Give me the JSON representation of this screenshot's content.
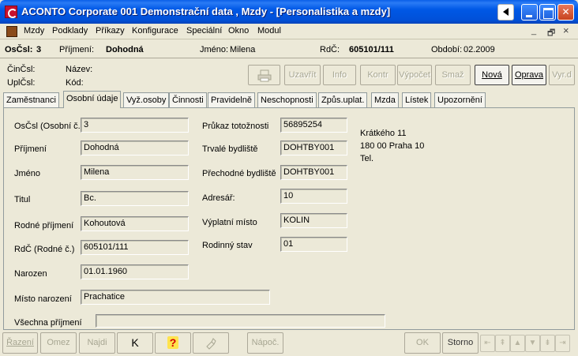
{
  "window": {
    "title": "ACONTO Corporate 001 Demonstrační data , Mzdy - [Personalistika a mzdy]"
  },
  "menu": [
    "Mzdy",
    "Podklady",
    "Příkazy",
    "Konfigurace",
    "Speciální",
    "Okno",
    "Modul"
  ],
  "mdi_controls": {
    "minimize": "_",
    "restore": "🗗",
    "close": "×"
  },
  "header": {
    "oscsl_label": "OsČsl:",
    "oscsl_value": "3",
    "prijmeni_label": "Příjmení:",
    "prijmeni_value": "Dohodná",
    "jmeno_label": "Jméno:",
    "jmeno_value": "Milena",
    "rdc_label": "RdČ:",
    "rdc_value": "605101/111",
    "obdobi_label": "Období:",
    "obdobi_value": "02.2009"
  },
  "info": {
    "cincsl": "ČinČsl:",
    "nazev": "Název:",
    "uplcsl": "UplČsl:",
    "kod": "Kód:"
  },
  "toolbar": {
    "print_icon": "printer-icon",
    "uzavrit": "Uzavřít",
    "info": "Info",
    "kontr": "Kontr",
    "vypocet": "Výpočet",
    "smaz": "Smaž",
    "nova": "Nová",
    "oprava": "Oprava",
    "vyrd": "Vyr.d"
  },
  "tabs": [
    "Zaměstnanci",
    "Osobní údaje",
    "Vyž.osoby",
    "Činnosti",
    "Pravidelně",
    "Neschopnosti",
    "Způs.uplat.",
    "Mzda",
    "Lístek",
    "Upozornění"
  ],
  "active_tab": "Osobní údaje",
  "form": {
    "oscsl": {
      "label": "OsČsl (Osobní č.)",
      "value": "3"
    },
    "prijmeni": {
      "label": "Příjmení",
      "value": "Dohodná"
    },
    "jmeno": {
      "label": "Jméno",
      "value": "Milena"
    },
    "titul": {
      "label": "Titul",
      "value": "Bc."
    },
    "rodne_prijmeni": {
      "label": "Rodné příjmení",
      "value": "Kohoutová"
    },
    "rdc": {
      "label": "RdČ (Rodné č.)",
      "value": "605101/111"
    },
    "narozen": {
      "label": "Narozen",
      "value": "01.01.1960"
    },
    "misto_narozeni": {
      "label": "Místo narození",
      "value": "Prachatice"
    },
    "vsechna_prijmeni": {
      "label": "Všechna příjmení",
      "value": ""
    },
    "prukaz": {
      "label": "Průkaz totožnosti",
      "value": "56895254"
    },
    "trvale": {
      "label": "Trvalé bydliště",
      "value": "DOHTBY001"
    },
    "prechodne": {
      "label": "Přechodné bydliště",
      "value": "DOHTBY001"
    },
    "adresar": {
      "label": "Adresář:",
      "value": "10"
    },
    "vyplatni": {
      "label": "Výplatní místo",
      "value": "KOLIN"
    },
    "rodinny": {
      "label": "Rodinný stav",
      "value": "01"
    }
  },
  "address": {
    "line1": "Krátkého 11",
    "line2": "180 00 Praha 10",
    "line3": "Tel."
  },
  "bottom": {
    "razeni": "Řazení",
    "omez": "Omez",
    "najdi": "Najdi",
    "k": "K",
    "help": "?",
    "napoc": "Nápoč.",
    "ok": "OK",
    "storno": "Storno"
  }
}
